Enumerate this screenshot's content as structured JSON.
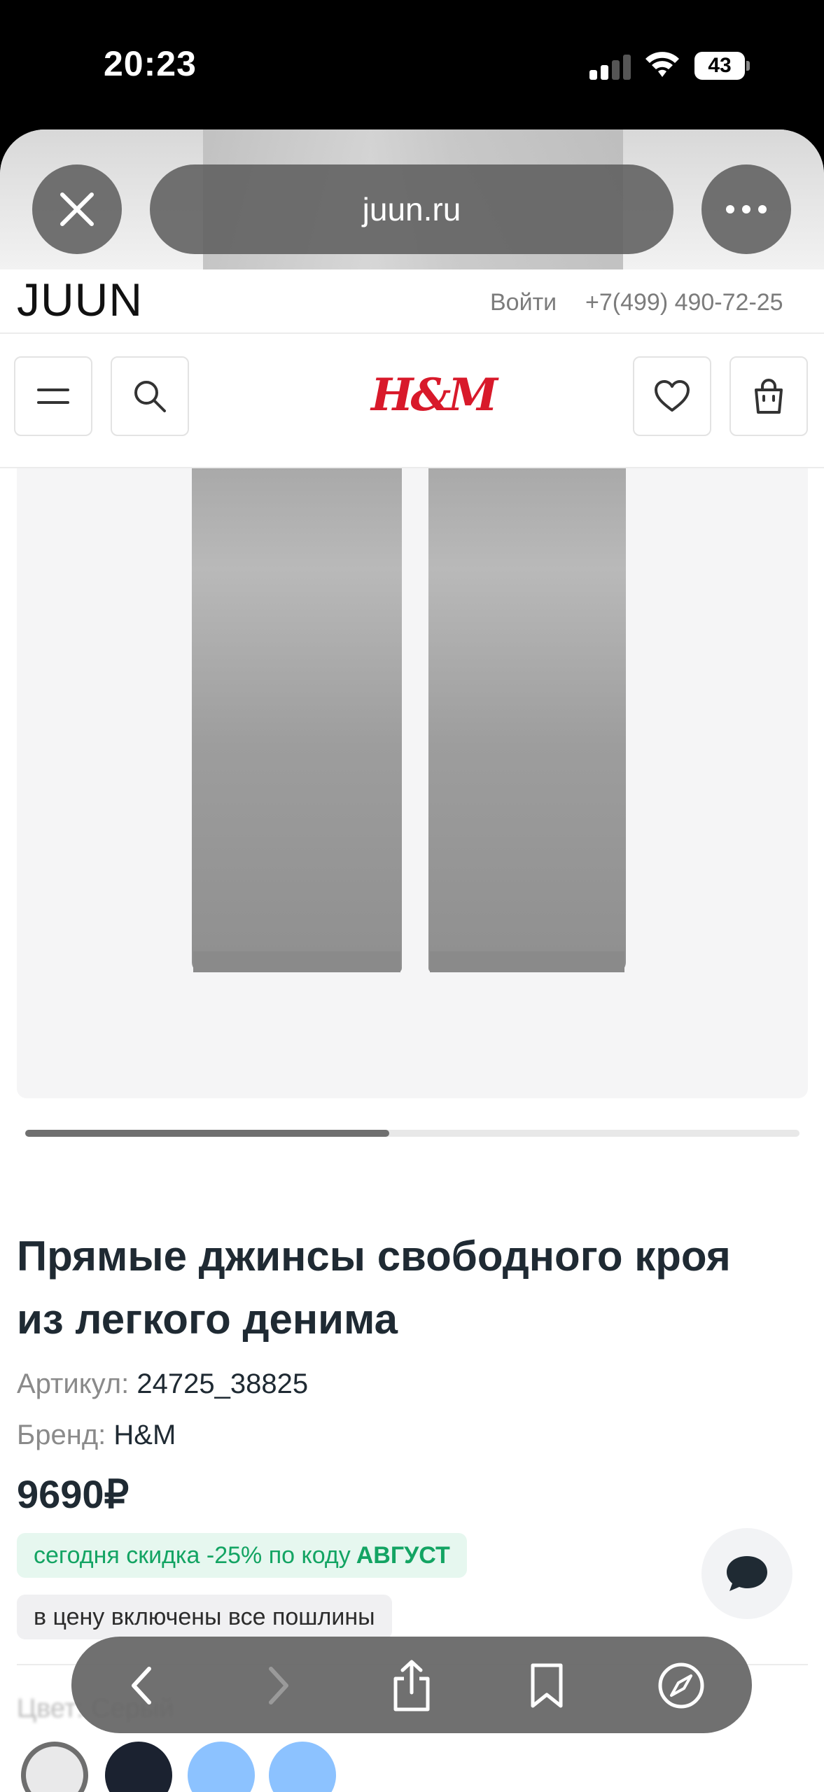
{
  "status_bar": {
    "time": "20:23",
    "battery": "43",
    "icons": [
      "signal-icon",
      "wifi-icon",
      "battery-icon"
    ]
  },
  "browser": {
    "url": "juun.ru",
    "icons": [
      "close-icon",
      "more-icon"
    ]
  },
  "site": {
    "logo": "JUUN",
    "login": "Войти",
    "phone": "+7(499) 490-72-25",
    "brand_logo": "H&M",
    "icons": [
      "menu-icon",
      "search-icon",
      "heart-icon",
      "cart-icon"
    ]
  },
  "gallery": {
    "progress": 0.47
  },
  "product": {
    "title": "Прямые джинсы свободного кроя из легкого денима",
    "article_label": "Артикул:",
    "article_value": "24725_38825",
    "brand_label": "Бренд:",
    "brand_value": "H&M",
    "price": "9690₽",
    "promo_text": "сегодня скидка -25% по коду",
    "promo_code": "АВГУСТ",
    "duty_note": "в цену включены все пошлины",
    "color_label": "Цвет: Серый",
    "swatch_colors": [
      "#e9e9ea",
      "#1b2230",
      "#8cc2ff",
      "#8cc2ff"
    ]
  },
  "toolbar": {
    "icons": [
      "back-icon",
      "forward-icon",
      "share-icon",
      "bookmarks-icon",
      "compass-icon"
    ]
  },
  "colors": {
    "promo_green": "#13a463",
    "brand_red": "#d8192a",
    "text_dark": "#1f2a33"
  }
}
